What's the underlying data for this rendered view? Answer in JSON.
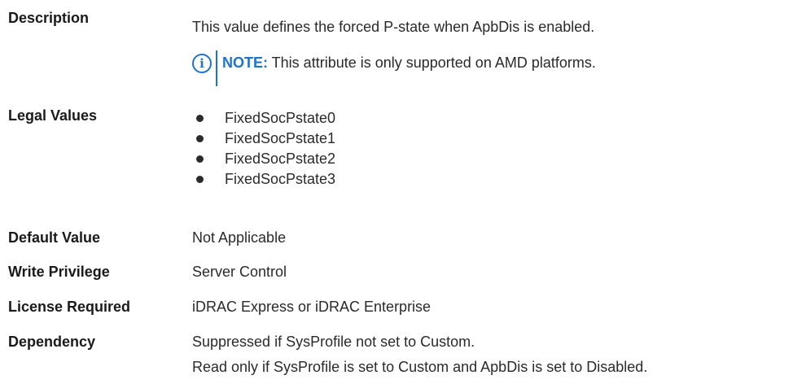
{
  "rows": {
    "description": {
      "label": "Description",
      "value": "This value defines the forced P-state when ApbDis is enabled."
    },
    "note": {
      "icon": "info-icon",
      "icon_glyph": "i",
      "keyword": "NOTE:",
      "text": " This attribute is only supported on AMD platforms."
    },
    "legal_values": {
      "label": "Legal Values",
      "items": [
        "FixedSocPstate0",
        "FixedSocPstate1",
        "FixedSocPstate2",
        "FixedSocPstate3"
      ]
    },
    "default_value": {
      "label": "Default Value",
      "value": "Not Applicable"
    },
    "write_privilege": {
      "label": "Write Privilege",
      "value": "Server Control"
    },
    "license_required": {
      "label": "License Required",
      "value": "iDRAC Express or iDRAC Enterprise"
    },
    "dependency": {
      "label": "Dependency",
      "lines": [
        "Suppressed if SysProfile not set to Custom.",
        "Read only if SysProfile is set to Custom and ApbDis is set to Disabled."
      ]
    }
  },
  "colors": {
    "note_accent": "#1f74c9",
    "text": "#2a2a2a"
  }
}
